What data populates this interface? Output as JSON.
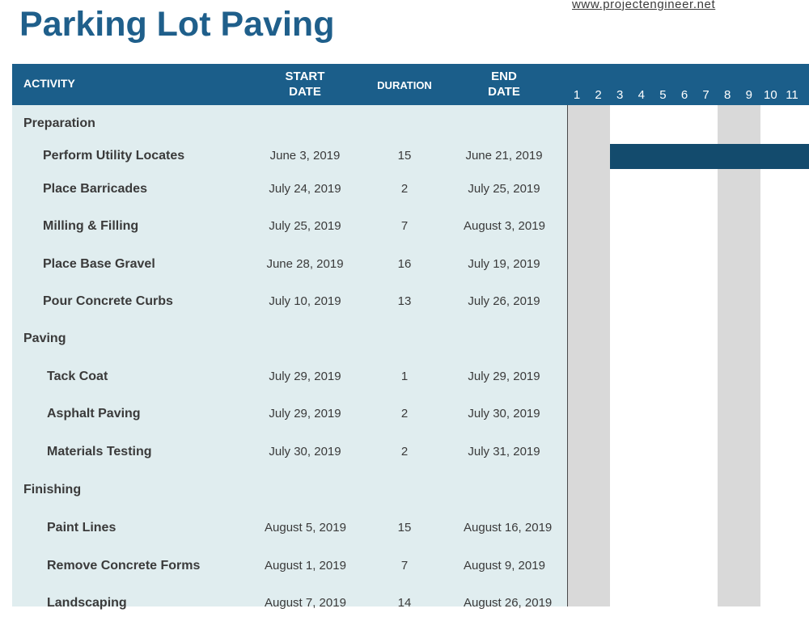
{
  "page": {
    "title": "Parking Lot Paving",
    "site_link": "www.projectengineer.net"
  },
  "header": {
    "activity": "ACTIVITY",
    "start_line1": "START",
    "start_line2": "DATE",
    "duration": "DURATION",
    "end_line1": "END",
    "end_line2": "DATE",
    "days": [
      "1",
      "2",
      "3",
      "4",
      "5",
      "6",
      "7",
      "8",
      "9",
      "10",
      "11"
    ]
  },
  "colors": {
    "title": "#1f5f8b",
    "header_bg": "#1b5e8a",
    "panel_bg": "#e0edef",
    "weekend": "#d9d9d9",
    "bar": "#134b6d"
  },
  "rows": [
    {
      "type": "category",
      "activity": "Preparation"
    },
    {
      "type": "task",
      "activity": "Perform Utility Locates",
      "start": "June 3, 2019",
      "duration": "15",
      "end": "June 21, 2019",
      "bar_from_day": 3
    },
    {
      "type": "task",
      "activity": "Place Barricades",
      "start": "July 24, 2019",
      "duration": "2",
      "end": "July 25, 2019"
    },
    {
      "type": "task",
      "activity": "Milling & Filling",
      "start": "July 25, 2019",
      "duration": "7",
      "end": "August 3, 2019"
    },
    {
      "type": "task",
      "activity": "Place Base Gravel",
      "start": "June 28, 2019",
      "duration": "16",
      "end": "July 19, 2019"
    },
    {
      "type": "task",
      "activity": "Pour Concrete Curbs",
      "start": "July 10, 2019",
      "duration": "13",
      "end": "July 26, 2019"
    },
    {
      "type": "category",
      "activity": "Paving"
    },
    {
      "type": "task",
      "activity": "Tack Coat",
      "start": "July 29, 2019",
      "duration": "1",
      "end": "July 29, 2019"
    },
    {
      "type": "task",
      "activity": "Asphalt Paving",
      "start": "July 29, 2019",
      "duration": "2",
      "end": "July 30, 2019"
    },
    {
      "type": "task",
      "activity": "Materials Testing",
      "start": "July 30, 2019",
      "duration": "2",
      "end": "July 31, 2019"
    },
    {
      "type": "category",
      "activity": "Finishing"
    },
    {
      "type": "task",
      "activity": "Paint Lines",
      "start": "August 5, 2019",
      "duration": "15",
      "end": "August 16, 2019"
    },
    {
      "type": "task",
      "activity": "Remove Concrete Forms",
      "start": "August 1, 2019",
      "duration": "7",
      "end": "August 9, 2019"
    },
    {
      "type": "task",
      "activity": "Landscaping",
      "start": "August 7, 2019",
      "duration": "14",
      "end": "August 26, 2019"
    }
  ]
}
